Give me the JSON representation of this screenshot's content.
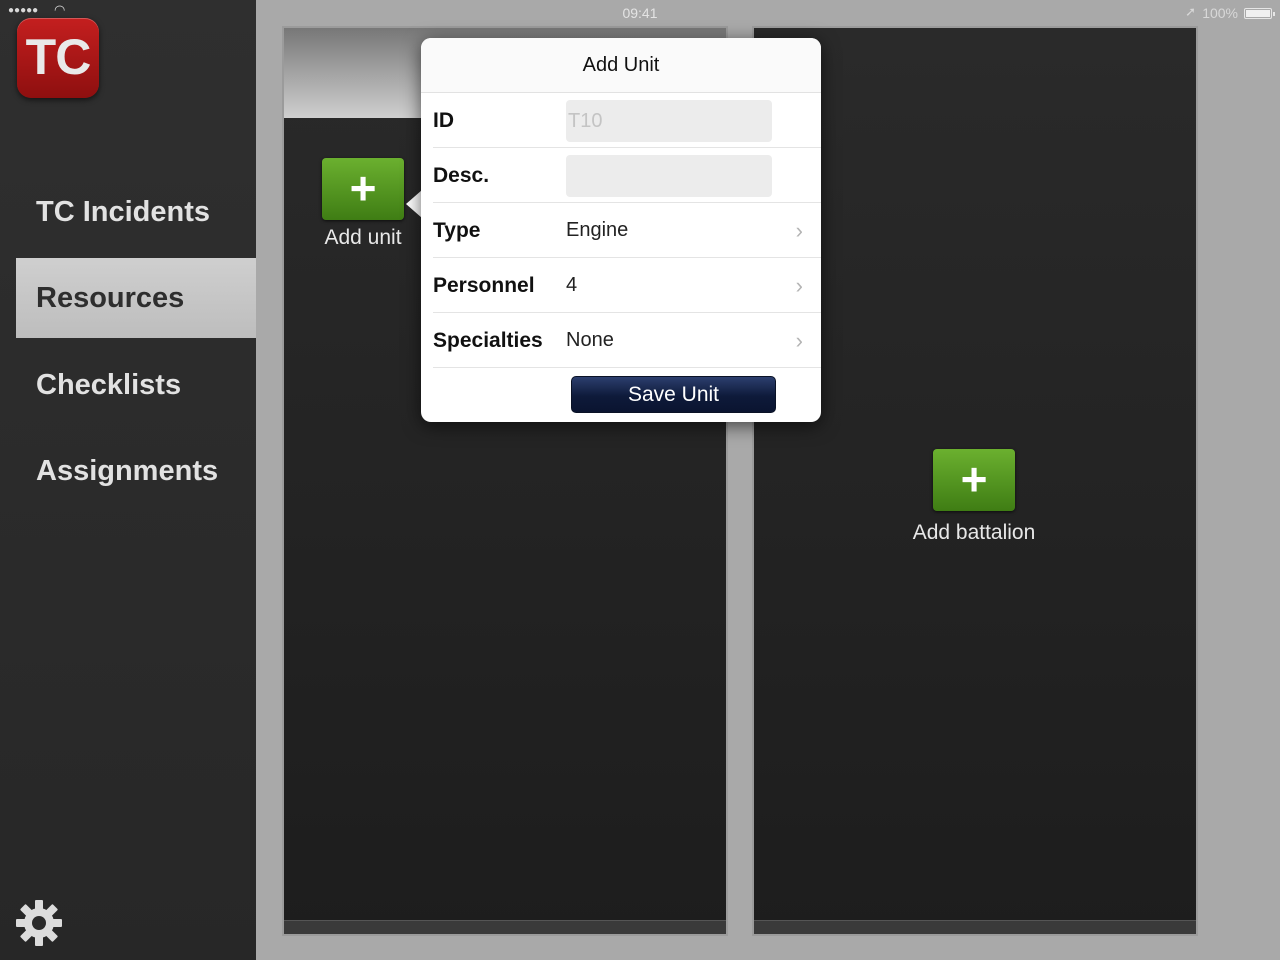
{
  "status_bar": {
    "signal": "●●●●●",
    "wifi_icon": "wifi-icon",
    "time": "09:41",
    "location_icon": "location-arrow-icon",
    "battery": "100%"
  },
  "sidebar": {
    "logo": "TC",
    "items": [
      {
        "label": "TC Incidents",
        "active": false
      },
      {
        "label": "Resources",
        "active": true
      },
      {
        "label": "Checklists",
        "active": false
      },
      {
        "label": "Assignments",
        "active": false
      }
    ],
    "settings_icon": "gear-icon"
  },
  "units_panel": {
    "add_label": "Add unit",
    "add_icon": "plus-icon"
  },
  "battalions_panel": {
    "add_label": "Add battalion",
    "add_icon": "plus-icon"
  },
  "add_unit_form": {
    "title": "Add Unit",
    "fields": {
      "id": {
        "label": "ID",
        "value": "",
        "placeholder": "T10"
      },
      "desc": {
        "label": "Desc.",
        "value": "",
        "placeholder": ""
      },
      "type": {
        "label": "Type",
        "value": "Engine"
      },
      "personnel": {
        "label": "Personnel",
        "value": "4"
      },
      "specialties": {
        "label": "Specialties",
        "value": "None"
      }
    },
    "save_label": "Save Unit"
  },
  "colors": {
    "logo_red": "#b01818",
    "add_green": "#5a9e25",
    "save_navy": "#0e1a3a",
    "active_nav": "#c4c4c4"
  }
}
